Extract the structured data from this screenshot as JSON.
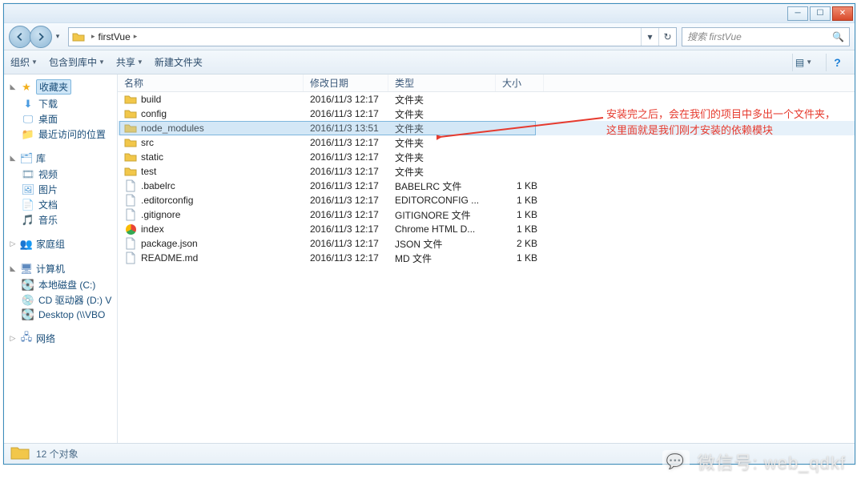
{
  "window": {
    "btn_min": "─",
    "btn_max": "☐",
    "btn_close": "✕"
  },
  "address": {
    "folder_name": "firstVue",
    "refresh_glyph": "↻",
    "dropdown_glyph": "▾"
  },
  "search": {
    "placeholder": "搜索 firstVue",
    "mag": "🔍"
  },
  "toolbar": {
    "organize": "组织",
    "include": "包含到库中",
    "share": "共享",
    "new_folder": "新建文件夹",
    "view_glyph": "▤",
    "help_glyph": "?"
  },
  "nav": {
    "favorites": {
      "label": "收藏夹",
      "items": [
        {
          "icon": "dl-ico",
          "glyph": "⬇",
          "label": "下载"
        },
        {
          "icon": "desk-ico",
          "glyph": "🖵",
          "label": "桌面"
        },
        {
          "icon": "recent-ico",
          "glyph": "📁",
          "label": "最近访问的位置"
        }
      ]
    },
    "libraries": {
      "label": "库",
      "items": [
        {
          "icon": "vid-ico",
          "glyph": "🎞",
          "label": "视频"
        },
        {
          "icon": "pic-ico",
          "glyph": "🖼",
          "label": "图片"
        },
        {
          "icon": "doc-ico",
          "glyph": "📄",
          "label": "文档"
        },
        {
          "icon": "mus-ico",
          "glyph": "🎵",
          "label": "音乐"
        }
      ]
    },
    "homegroup": {
      "label": "家庭组"
    },
    "computer": {
      "label": "计算机",
      "items": [
        {
          "icon": "drv-ico",
          "glyph": "💽",
          "label": "本地磁盘 (C:)"
        },
        {
          "icon": "cd-ico",
          "glyph": "💿",
          "label": "CD 驱动器 (D:) V"
        },
        {
          "icon": "net-ico",
          "glyph": "💽",
          "label": "Desktop (\\\\VBO"
        }
      ]
    },
    "network": {
      "label": "网络"
    }
  },
  "cols": {
    "name": "名称",
    "date": "修改日期",
    "type": "类型",
    "size": "大小"
  },
  "files": [
    {
      "kind": "folder",
      "name": "build",
      "date": "2016/11/3 12:17",
      "type": "文件夹",
      "size": ""
    },
    {
      "kind": "folder",
      "name": "config",
      "date": "2016/11/3 12:17",
      "type": "文件夹",
      "size": ""
    },
    {
      "kind": "folder",
      "name": "node_modules",
      "date": "2016/11/3 13:51",
      "type": "文件夹",
      "size": "",
      "selected": true
    },
    {
      "kind": "folder",
      "name": "src",
      "date": "2016/11/3 12:17",
      "type": "文件夹",
      "size": ""
    },
    {
      "kind": "folder",
      "name": "static",
      "date": "2016/11/3 12:17",
      "type": "文件夹",
      "size": ""
    },
    {
      "kind": "folder",
      "name": "test",
      "date": "2016/11/3 12:17",
      "type": "文件夹",
      "size": ""
    },
    {
      "kind": "file",
      "name": ".babelrc",
      "date": "2016/11/3 12:17",
      "type": "BABELRC 文件",
      "size": "1 KB"
    },
    {
      "kind": "file",
      "name": ".editorconfig",
      "date": "2016/11/3 12:17",
      "type": "EDITORCONFIG ...",
      "size": "1 KB"
    },
    {
      "kind": "file",
      "name": ".gitignore",
      "date": "2016/11/3 12:17",
      "type": "GITIGNORE 文件",
      "size": "1 KB"
    },
    {
      "kind": "chrome",
      "name": "index",
      "date": "2016/11/3 12:17",
      "type": "Chrome HTML D...",
      "size": "1 KB"
    },
    {
      "kind": "file",
      "name": "package.json",
      "date": "2016/11/3 12:17",
      "type": "JSON 文件",
      "size": "2 KB"
    },
    {
      "kind": "file",
      "name": "README.md",
      "date": "2016/11/3 12:17",
      "type": "MD 文件",
      "size": "1 KB"
    }
  ],
  "status": {
    "count_text": "12 个对象"
  },
  "annot": {
    "line1": "安装完之后，会在我们的项目中多出一个文件夹，",
    "line2": "这里面就是我们刚才安装的依赖模块"
  },
  "watermark": {
    "label": "微信号: web_qdkf"
  }
}
